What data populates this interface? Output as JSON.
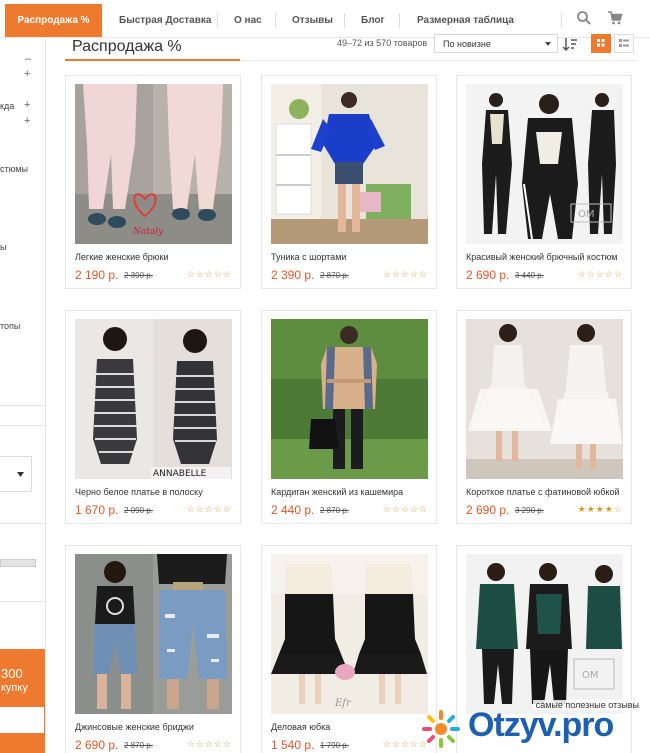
{
  "nav": {
    "active": "Распродажа %",
    "items": [
      "Быстрая Доставка",
      "О нас",
      "Отзывы",
      "Блог",
      "Размерная таблица"
    ]
  },
  "sidebar": {
    "fragments": [
      "кда",
      "стюмы",
      "ы",
      "топы"
    ],
    "promo": [
      "300",
      "купку"
    ]
  },
  "header": {
    "title": "Распродажа %",
    "count": "49–72 из 570 товаров",
    "sort": "По новизне"
  },
  "products": [
    {
      "name": "Легкие женские брюки",
      "price": "2 190 р.",
      "old": "2 390 р.",
      "rating": 0
    },
    {
      "name": "Туника с шортами",
      "price": "2 390 р.",
      "old": "2 870 р.",
      "rating": 0
    },
    {
      "name": "Красивый женский брючный костюм",
      "price": "2 690 р.",
      "old": "3 440 р.",
      "rating": 0
    },
    {
      "name": "Черно белое платье в полоску",
      "price": "1 670 р.",
      "old": "2 090 р.",
      "rating": 0
    },
    {
      "name": "Кардиган женский из кашемира",
      "price": "2 440 р.",
      "old": "2 870 р.",
      "rating": 0
    },
    {
      "name": "Короткое платье с фатиновой юбкой",
      "price": "2 690 р.",
      "old": "3 290 р.",
      "rating": 4
    },
    {
      "name": "Джинсовые женские бриджи",
      "price": "2 690 р.",
      "old": "2 870 р.",
      "rating": 0
    },
    {
      "name": "Деловая юбка",
      "price": "1 540 р.",
      "old": "1 790 р.",
      "rating": 0
    },
    {
      "name": "",
      "price": "",
      "old": "",
      "rating": 0
    }
  ],
  "photo_labels": {
    "p0": "Nataly",
    "p3": "ANNABELLE",
    "p7": "Efr"
  },
  "watermark": {
    "tagline": "самые полезные отзывы",
    "brand": "Otzyv.pro"
  },
  "colors": {
    "accent": "#ee7a2f",
    "price": "#e0572c",
    "brand_blue": "#1d5fb0"
  },
  "icons": [
    "search-icon",
    "cart-icon",
    "sort-direction-icon",
    "grid-view-icon",
    "list-view-icon",
    "star-icon"
  ]
}
